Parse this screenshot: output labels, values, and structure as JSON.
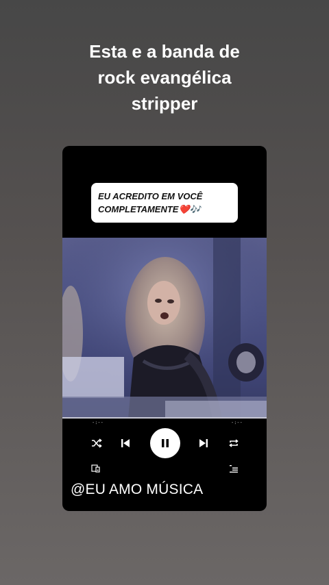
{
  "caption": {
    "line1": "Esta e a banda de",
    "line2": "rock evangélica",
    "line3": "stripper"
  },
  "card": {
    "quote_line1": "EU ACREDITO EM VOCÊ",
    "quote_line2": "COMPLETAMENTE❤️🎶",
    "elapsed_time": "-:--",
    "remaining_time": "-:--",
    "handle": "@EU AMO MÚSICA"
  },
  "icons": {
    "shuffle": "shuffle-icon",
    "previous": "previous-icon",
    "pause": "pause-icon",
    "next": "next-icon",
    "repeat": "repeat-icon",
    "devices": "devices-icon",
    "queue": "queue-icon"
  },
  "colors": {
    "card_background": "#000000",
    "video_tint": "#4d5386"
  }
}
